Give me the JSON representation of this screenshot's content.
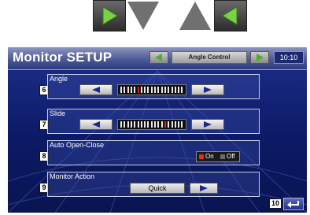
{
  "guide_arrows": {
    "right_icon": "play-right-icon",
    "down_icon": "triangle-down-icon",
    "up_icon": "triangle-up-icon",
    "left_icon": "play-left-icon"
  },
  "header": {
    "title": "Monitor SETUP",
    "control_label": "Angle Control",
    "clock": "10:10"
  },
  "rows": {
    "angle": {
      "label": "Angle",
      "badge": "6",
      "level": 5,
      "ticks": 19
    },
    "slide": {
      "label": "Slide",
      "badge": "7",
      "level": 13,
      "ticks": 19
    },
    "auto": {
      "label": "Auto Open-Close",
      "badge": "8",
      "on_label": "On",
      "off_label": "Off",
      "selected": "On"
    },
    "action": {
      "label": "Monitor Action",
      "badge": "9",
      "value": "Quick"
    }
  },
  "footer": {
    "badge": "10",
    "return_icon": "return-icon"
  },
  "colors": {
    "screen_top": "#1d2f8a",
    "screen_bottom": "#0a1450",
    "active_tick": "#d91f1f",
    "on_indicator": "#e0301e",
    "off_indicator": "#6b6b6b",
    "guide_green": "#6abf3a",
    "guide_gray": "#6a6a6a"
  }
}
